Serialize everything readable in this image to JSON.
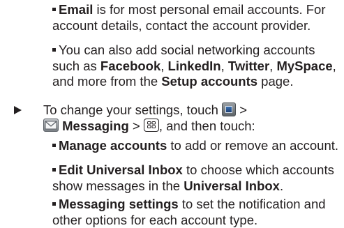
{
  "bullets_top": [
    {
      "bold": "Email",
      "text": " is for most personal email accounts. For account details, contact the account provider."
    },
    {
      "pre": "You can also add social networking accounts such as ",
      "bold1": "Facebook",
      "sep1": ", ",
      "bold2": "LinkedIn",
      "sep2": ", ",
      "bold3": "Twitter",
      "sep3": ", ",
      "bold4": "MySpace",
      "mid": ", and more from the ",
      "bold5": "Setup accounts",
      "post": " page."
    }
  ],
  "step": {
    "pre": "To change your settings, touch ",
    "gt1": " >",
    "bold": "Messaging",
    "gt2": " > ",
    "post": ", and then touch:"
  },
  "bullets_bottom": [
    {
      "bold": "Manage accounts",
      "text": " to add or remove an account."
    },
    {
      "bold": "Edit Universal Inbox",
      "text": " to choose which accounts show messages in the ",
      "bold2": "Universal Inbox",
      "end": "."
    },
    {
      "bold": "Messaging settings",
      "text": " to set the notification and other options for each account type."
    }
  ],
  "icons": {
    "apps": "apps-launcher-icon",
    "messaging": "messaging-envelope-icon",
    "menu": "menu-key-icon"
  }
}
